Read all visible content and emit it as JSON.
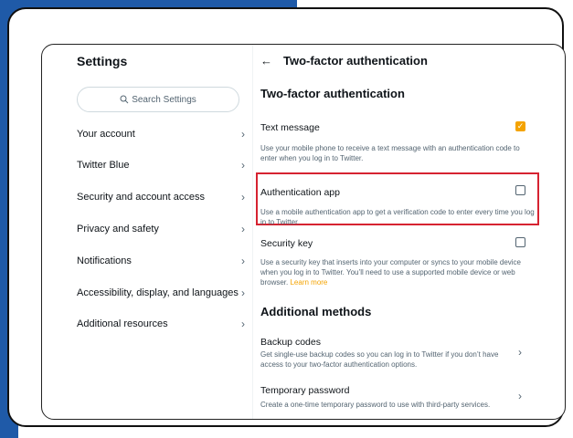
{
  "settings": {
    "title": "Settings",
    "search_placeholder": "Search Settings",
    "nav_items": [
      {
        "label": "Your account"
      },
      {
        "label": "Twitter Blue"
      },
      {
        "label": "Security and account access"
      },
      {
        "label": "Privacy and safety"
      },
      {
        "label": "Notifications"
      },
      {
        "label": "Accessibility, display, and languages"
      },
      {
        "label": "Additional resources"
      }
    ]
  },
  "panel": {
    "header_title": "Two-factor authentication",
    "section_title": "Two-factor authentication",
    "options": [
      {
        "label": "Text message",
        "description": "Use your mobile phone to receive a text message with an authentication code to enter when you log in to Twitter.",
        "checked": true
      },
      {
        "label": "Authentication app",
        "description": "Use a mobile authentication app to get a verification code to enter every time you log in to Twitter.",
        "checked": false
      },
      {
        "label": "Security key",
        "description": "Use a security key that inserts into your computer or syncs to your mobile device when you log in to Twitter. You’ll need to use a supported mobile device or web browser.",
        "learn_more": "Learn more",
        "checked": false
      }
    ],
    "additional_title": "Additional methods",
    "additional": [
      {
        "label": "Backup codes",
        "description": "Get single-use backup codes so you can log in to Twitter if you don’t have access to your two-factor authentication options."
      },
      {
        "label": "Temporary password",
        "description": "Create a one-time temporary password to use with third-party services."
      }
    ]
  },
  "colors": {
    "accent": "#f4a300",
    "highlight": "#d62331",
    "frame_blue": "#1f5aa8"
  }
}
